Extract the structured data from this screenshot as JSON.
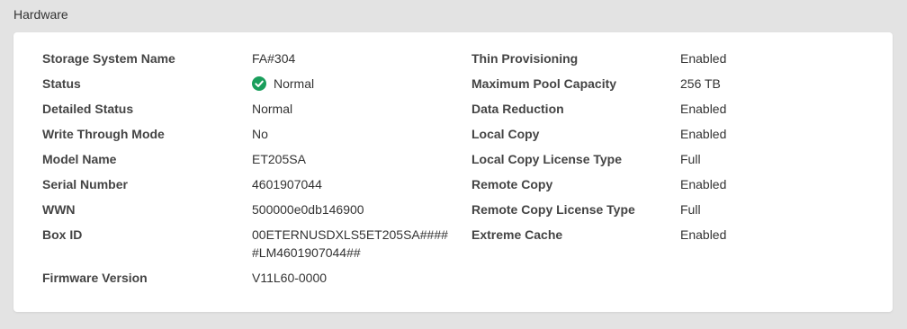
{
  "section": {
    "title": "Hardware"
  },
  "colors": {
    "status_ok": "#1a9e5c",
    "panel_bg": "#ffffff",
    "page_bg": "#e3e3e3"
  },
  "left": {
    "storage_system_name": {
      "label": "Storage System Name",
      "value": "FA#304"
    },
    "status": {
      "label": "Status",
      "value": "Normal",
      "icon": "check-circle-icon"
    },
    "detailed_status": {
      "label": "Detailed Status",
      "value": "Normal"
    },
    "write_through_mode": {
      "label": "Write Through Mode",
      "value": "No"
    },
    "model_name": {
      "label": "Model Name",
      "value": "ET205SA"
    },
    "serial_number": {
      "label": "Serial Number",
      "value": "4601907044"
    },
    "wwn": {
      "label": "WWN",
      "value": "500000e0db146900"
    },
    "box_id": {
      "label": "Box ID",
      "value_line1": "00ETERNUSDXLS5ET205SA####",
      "value_line2": "#LM4601907044##"
    },
    "firmware_version": {
      "label": "Firmware Version",
      "value": "V11L60-0000"
    }
  },
  "right": {
    "thin_provisioning": {
      "label": "Thin Provisioning",
      "value": "Enabled"
    },
    "maximum_pool_capacity": {
      "label": "Maximum Pool Capacity",
      "value": "256 TB"
    },
    "data_reduction": {
      "label": "Data Reduction",
      "value": "Enabled"
    },
    "local_copy": {
      "label": "Local Copy",
      "value": "Enabled"
    },
    "local_copy_license_type": {
      "label": "Local Copy License Type",
      "value": "Full"
    },
    "remote_copy": {
      "label": "Remote Copy",
      "value": "Enabled"
    },
    "remote_copy_license_type": {
      "label": "Remote Copy License Type",
      "value": "Full"
    },
    "extreme_cache": {
      "label": "Extreme Cache",
      "value": "Enabled"
    }
  }
}
